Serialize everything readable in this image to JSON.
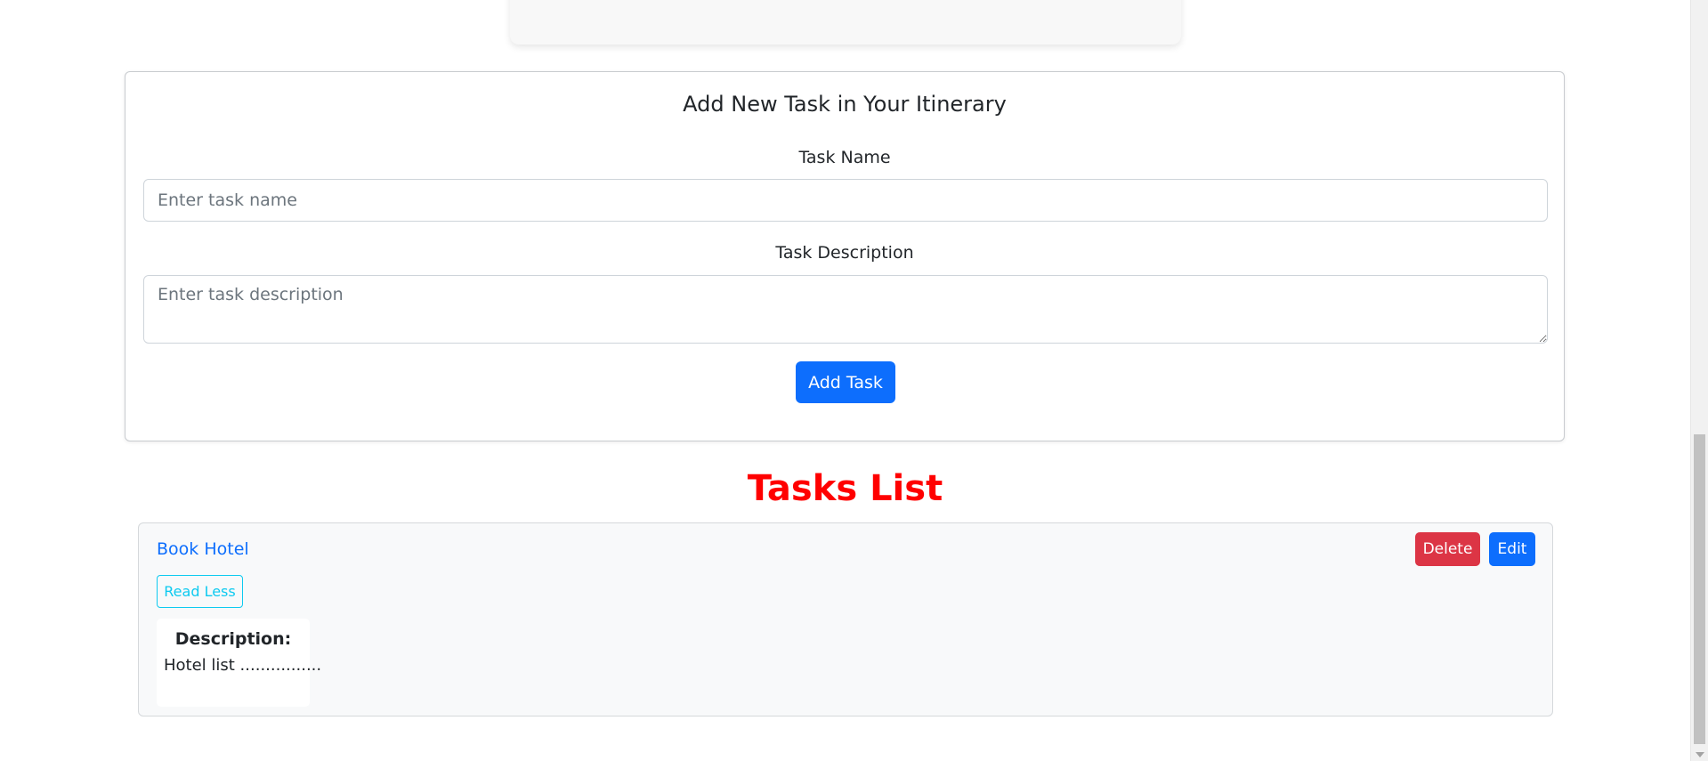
{
  "form": {
    "title": "Add New Task in Your Itinerary",
    "task_name_label": "Task Name",
    "task_name_placeholder": "Enter task name",
    "task_description_label": "Task Description",
    "task_description_placeholder": "Enter task description",
    "submit_label": "Add Task"
  },
  "tasks": {
    "heading": "Tasks List",
    "heading_color": "#ff0000",
    "items": [
      {
        "title": "Book Hotel",
        "read_toggle_label": "Read Less",
        "delete_label": "Delete",
        "edit_label": "Edit",
        "description_label": "Description:",
        "description": "Hotel list ................"
      }
    ]
  },
  "colors": {
    "primary": "#0d6efd",
    "danger": "#dc3545",
    "info": "#0dcaf0"
  }
}
